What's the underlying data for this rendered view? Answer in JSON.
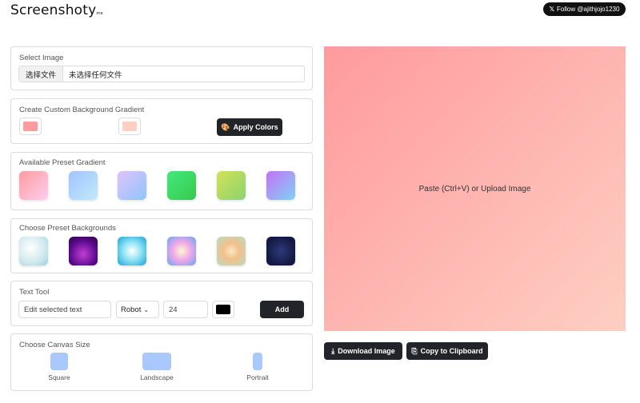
{
  "header": {
    "logo": "Screenshoty",
    "logo_suffix": "me",
    "follow_label": "Follow @ajithjojo1230",
    "follow_icon": "x-logo-icon"
  },
  "select_image": {
    "title": "Select Image",
    "file_button": "选择文件",
    "file_status": "未选择任何文件"
  },
  "custom_gradient": {
    "title": "Create Custom Background Gradient",
    "color1": "#ff9a9e",
    "color2": "#fecfc2",
    "apply_label": "Apply Colors",
    "apply_icon": "palette-icon"
  },
  "preset_gradients": {
    "title": "Available Preset Gradient",
    "items": [
      "linear-gradient(135deg,#ff9a9e,#fecfef)",
      "linear-gradient(135deg,#a1c4fd,#c2e9fb)",
      "linear-gradient(135deg,#e0c3fc,#8ec5fc)",
      "linear-gradient(135deg,#43e97b,#38c94e)",
      "linear-gradient(135deg,#d4e157,#8bd46e)",
      "linear-gradient(135deg,#c471f5,#7fd3f7)"
    ]
  },
  "preset_backgrounds": {
    "title": "Choose Preset Backgrounds",
    "items": [
      "radial-gradient(circle at 40% 40%,#ffffff,#cfe9ee 60%,#9fcfd9)",
      "radial-gradient(circle at 50% 60%,#c23ed6,#5a0a8c 60%,#2a0540)",
      "radial-gradient(circle at 50% 50%,#ffffff,#8fe3f5 45%,#1aa3d6)",
      "radial-gradient(circle at 50% 50%,#fff7d0,#f0a8e8 45%,#6aa5f0)",
      "radial-gradient(circle at 50% 50%,#fbe7c6,#f3c08a 40%,#b7dcc4)",
      "radial-gradient(circle at 50% 50%,#2e3b7a,#141a45 70%)"
    ]
  },
  "text_tool": {
    "title": "Text Tool",
    "placeholder": "Edit selected text",
    "font": "Robot",
    "size": "24",
    "color": "#000000",
    "add_label": "Add"
  },
  "canvas_size": {
    "title": "Choose Canvas Size",
    "options": [
      "Square",
      "Landscape",
      "Portrait"
    ]
  },
  "preview": {
    "text": "Paste (Ctrl+V) or Upload Image"
  },
  "actions": {
    "download_label": "Download Image",
    "download_icon": "download-icon",
    "copy_label": "Copy to Clipboard",
    "copy_icon": "clipboard-icon"
  }
}
